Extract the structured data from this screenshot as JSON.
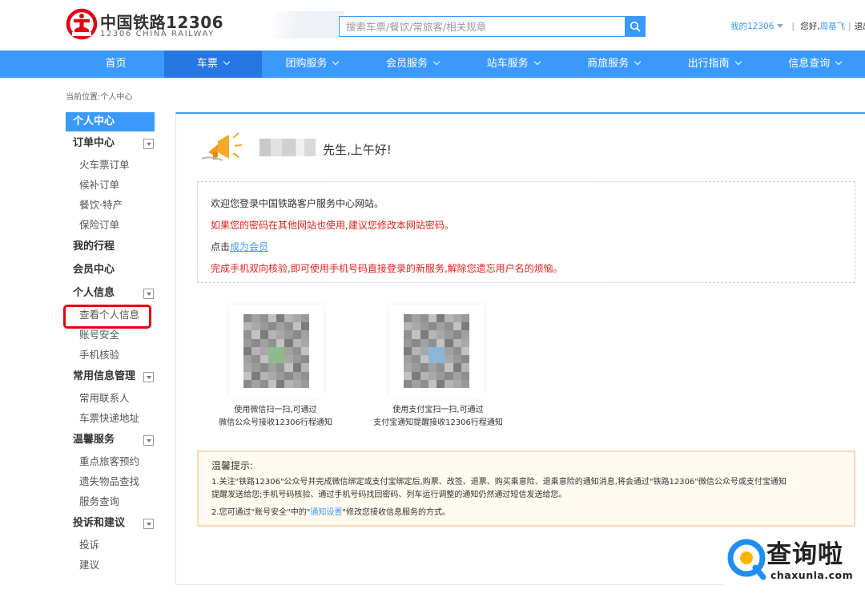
{
  "header": {
    "logo_cn": "中国铁路12306",
    "logo_en": "12306 CHINA RAILWAY",
    "search_placeholder": "搜索车票/餐饮/常旅客/相关规章",
    "my12306": "我的12306",
    "hello": "您好,",
    "username": "周基飞",
    "logout": "退出"
  },
  "nav": {
    "items": [
      {
        "label": "首页"
      },
      {
        "label": "车票"
      },
      {
        "label": "团购服务"
      },
      {
        "label": "会员服务"
      },
      {
        "label": "站车服务"
      },
      {
        "label": "商旅服务"
      },
      {
        "label": "出行指南"
      },
      {
        "label": "信息查询"
      }
    ]
  },
  "breadcrumb": "当前位置:个人中心",
  "sidebar": {
    "head": "个人中心",
    "groups": [
      {
        "label": "订单中心",
        "items": [
          "火车票订单",
          "候补订单",
          "餐饮·特产",
          "保险订单"
        ]
      },
      {
        "label": "我的行程",
        "items": []
      },
      {
        "label": "会员中心",
        "items": []
      },
      {
        "label": "个人信息",
        "items": [
          "查看个人信息",
          "账号安全",
          "手机核验"
        ]
      },
      {
        "label": "常用信息管理",
        "items": [
          "常用联系人",
          "车票快递地址"
        ]
      },
      {
        "label": "温馨服务",
        "items": [
          "重点旅客预约",
          "遗失物品查找",
          "服务查询"
        ]
      },
      {
        "label": "投诉和建议",
        "items": [
          "投诉",
          "建议"
        ]
      }
    ]
  },
  "main": {
    "greeting": "先生,上午好!",
    "notice": {
      "line1": "欢迎您登录中国铁路客户服务中心网站。",
      "line2": "如果您的密码在其他网站也使用,建议您修改本网站密码。",
      "line3_prefix": "点击",
      "line3_link": "成为会员",
      "line4": "完成手机双向核验,即可使用手机号码直接登录的新服务,解除您遗忘用户名的烦恼。"
    },
    "qr_wechat": {
      "line1": "使用微信扫一扫,可通过",
      "line2": "微信公众号接收12306行程通知"
    },
    "qr_alipay": {
      "line1": "使用支付宝扫一扫,可通过",
      "line2": "支付宝通知提醒接收12306行程通知"
    },
    "tips": {
      "title": "温馨提示:",
      "p1": "1.关注\"铁路12306\"公众号并完成微信绑定或支付宝绑定后,购票、改签、退票、购买乘意险、退乘意险的通知消息,将会通过\"铁路12306\"微信公众号或支付宝通知",
      "p1b": "提醒发送给您;手机号码核验、通过手机号码找回密码、列车运行调整的通知仍然通过短信发送给您。",
      "p2_prefix": "2.您可通过\"账号安全\"中的\"",
      "p2_link": "通知设置",
      "p2_suffix": "\"修改您接收信息服务的方式。"
    }
  },
  "watermark": {
    "text": "查询啦",
    "sub": "chaxunla.com"
  },
  "colors": {
    "primary": "#3b99fc",
    "nav_active": "#2676e3",
    "warn_red": "#e3211d",
    "logo_red": "#e60012"
  }
}
